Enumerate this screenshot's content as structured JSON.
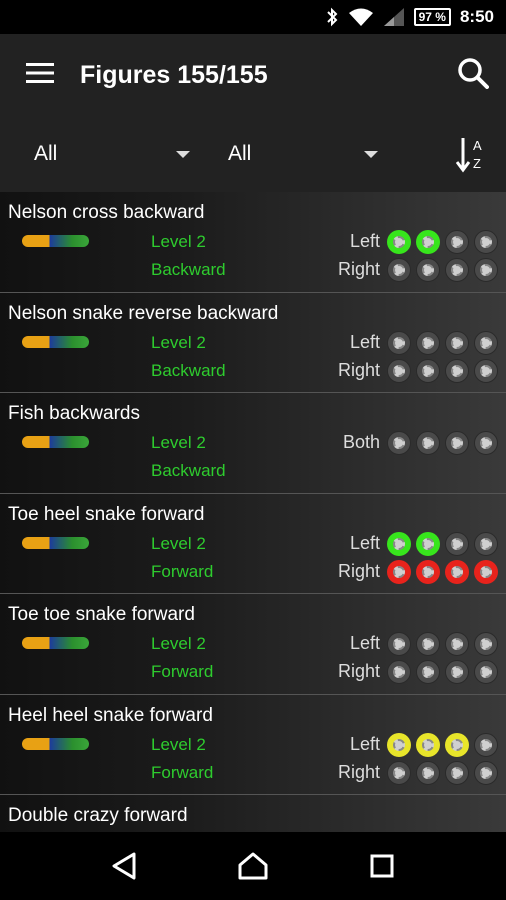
{
  "status": {
    "battery": "97 %",
    "time": "8:50"
  },
  "app_bar": {
    "title": "Figures 155/155"
  },
  "filters": {
    "filter1": "All",
    "filter2": "All"
  },
  "sort_icon": {
    "top": "A",
    "bottom": "Z"
  },
  "figures": [
    {
      "name": "Nelson cross backward",
      "level": "Level 2",
      "direction": "Backward",
      "sides": [
        {
          "label": "Left",
          "dots": [
            "green",
            "green",
            "gray",
            "gray"
          ]
        },
        {
          "label": "Right",
          "dots": [
            "gray",
            "gray",
            "gray",
            "gray"
          ]
        }
      ]
    },
    {
      "name": "Nelson snake reverse backward",
      "level": "Level 2",
      "direction": "Backward",
      "sides": [
        {
          "label": "Left",
          "dots": [
            "gray",
            "gray",
            "gray",
            "gray"
          ]
        },
        {
          "label": "Right",
          "dots": [
            "gray",
            "gray",
            "gray",
            "gray"
          ]
        }
      ]
    },
    {
      "name": "Fish backwards",
      "level": "Level 2",
      "direction": "Backward",
      "sides": [
        {
          "label": "Both",
          "dots": [
            "gray",
            "gray",
            "gray",
            "gray"
          ]
        }
      ]
    },
    {
      "name": "Toe heel snake forward",
      "level": "Level 2",
      "direction": "Forward",
      "sides": [
        {
          "label": "Left",
          "dots": [
            "green",
            "green",
            "gray",
            "gray"
          ]
        },
        {
          "label": "Right",
          "dots": [
            "red",
            "red",
            "red",
            "red"
          ]
        }
      ]
    },
    {
      "name": "Toe toe snake forward",
      "level": "Level 2",
      "direction": "Forward",
      "sides": [
        {
          "label": "Left",
          "dots": [
            "gray",
            "gray",
            "gray",
            "gray"
          ]
        },
        {
          "label": "Right",
          "dots": [
            "gray",
            "gray",
            "gray",
            "gray"
          ]
        }
      ]
    },
    {
      "name": "Heel heel snake forward",
      "level": "Level 2",
      "direction": "Forward",
      "sides": [
        {
          "label": "Left",
          "dots": [
            "yellow",
            "yellow",
            "yellow",
            "gray"
          ]
        },
        {
          "label": "Right",
          "dots": [
            "gray",
            "gray",
            "gray",
            "gray"
          ]
        }
      ]
    },
    {
      "name": "Double crazy forward",
      "level": "",
      "direction": "",
      "sides": []
    }
  ],
  "colors": {
    "green": "#37e51c",
    "red": "#e8231c",
    "yellow": "#e8e52a",
    "gray": "#4a4a4a",
    "level_text": "#2ecc2e"
  },
  "icons": [
    "bluetooth-icon",
    "wifi-icon",
    "cell-signal-icon",
    "battery-icon",
    "menu-icon",
    "search-icon",
    "chevron-down-icon",
    "sort-az-icon",
    "back-icon",
    "home-icon",
    "recents-icon",
    "progress-dot-icon"
  ]
}
